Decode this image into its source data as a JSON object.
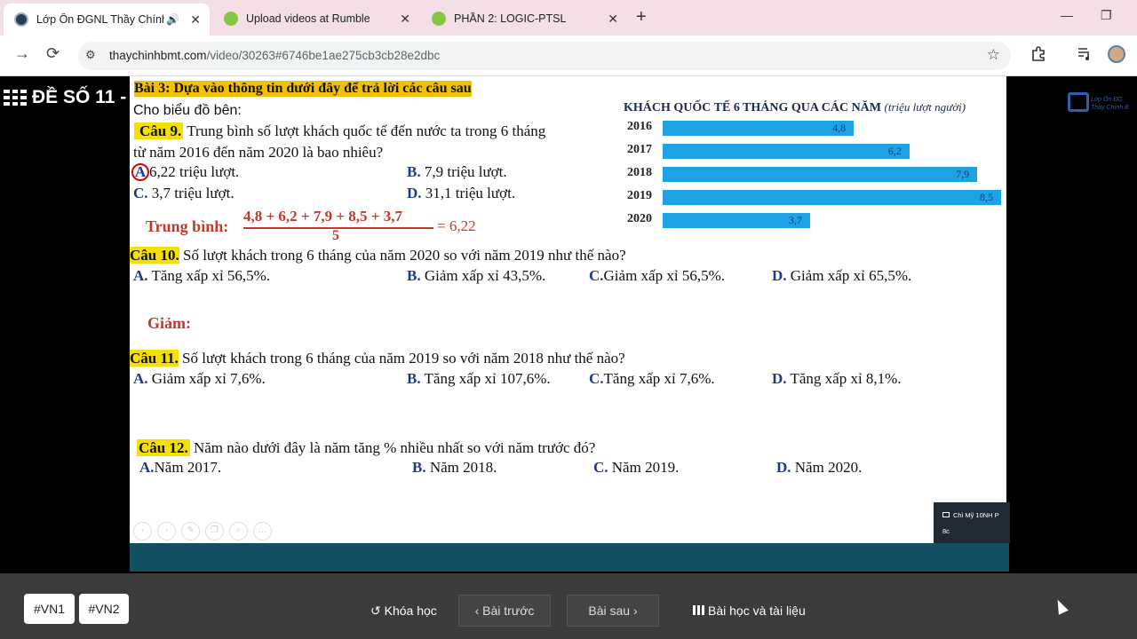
{
  "browser": {
    "tabs": [
      {
        "title": "Lớp Ôn ĐGNL Thầy Chính B",
        "active": true,
        "audio": true
      },
      {
        "title": "Upload videos at Rumble",
        "active": false
      },
      {
        "title": "PHẦN 2: LOGIC-PTSL",
        "active": false
      }
    ],
    "url_host": "thaychinhbmt.com",
    "url_path": "/video/30263#6746be1ae275cb3cb28e2dbc",
    "icons": {
      "back": "arrow-right-icon",
      "reload": "reload-icon",
      "bookmark": "star-icon",
      "extensions": "puzzle-icon",
      "media": "media-control-icon"
    },
    "symbols": {
      "newtab": "+",
      "close": "✕",
      "minimize": "—",
      "restore": "❐",
      "back": "→",
      "reload": "⟳",
      "star": "☆",
      "tune": "⚙",
      "audio": "🔊"
    }
  },
  "course": {
    "title": "ĐỀ SỐ 11 -",
    "logo_text1": "Lớp Ôn ĐG",
    "logo_text2": "Thầy Chính B"
  },
  "slide": {
    "heading": "Bài 3: Dựa vào thông tin dưới đây để trả lời các câu sau",
    "intro": "Cho biểu đồ bên:",
    "q9": {
      "num": "Câu 9.",
      "text1": "Trung bình số lượt khách quốc tế đến nước ta trong 6 tháng",
      "text2": "từ năm 2016 đến năm 2020 là bao nhiêu?",
      "a_label": "A",
      "a": "6,22 triệu lượt.",
      "b_label": "B.",
      "b": "7,9 triệu lượt.",
      "c_label": "C.",
      "c": "3,7 triệu lượt.",
      "d_label": "D.",
      "d": "31,1 triệu lượt."
    },
    "avg_label": "Trung bình:",
    "avg_num": "4,8 + 6,2 + 7,9 + 8,5 + 3,7",
    "avg_den": "5",
    "avg_result": "= 6,22",
    "q10": {
      "num": "Câu 10.",
      "text": "Số lượt khách trong 6 tháng của năm 2020 so với năm 2019 như thế nào?",
      "a_label": "A.",
      "a": "Tăng xấp xỉ 56,5%.",
      "b_label": "B.",
      "b": "Giảm xấp xỉ 43,5%.",
      "c_label": "C.",
      "c": "Giảm xấp xỉ 56,5%.",
      "d_label": "D.",
      "d": "Giảm xấp xỉ 65,5%."
    },
    "note": "Giảm:",
    "q11": {
      "num": "Câu 11.",
      "text": "Số lượt khách trong 6 tháng của năm 2019 so với năm 2018 như thế nào?",
      "a_label": "A.",
      "a": "Giảm xấp xỉ 7,6%.",
      "b_label": "B.",
      "b": "Tăng xấp xỉ 107,6%.",
      "c_label": "C.",
      "c": "Tăng xấp xỉ 7,6%.",
      "d_label": "D.",
      "d": "Tăng xấp xỉ 8,1%."
    },
    "q12": {
      "num": "Câu 12.",
      "text": "Năm nào dưới đây là năm tăng % nhiều nhất so với năm trước đó?",
      "a_label": "A.",
      "a": "Năm 2017.",
      "b_label": "B.",
      "b": "Năm 2018.",
      "c_label": "C.",
      "c": "Năm 2019.",
      "d_label": "D.",
      "d": "Năm 2020."
    }
  },
  "chart_data": {
    "type": "bar",
    "orientation": "horizontal",
    "title": "KHÁCH QUỐC TẾ 6 THÁNG QUA CÁC NĂM",
    "subtitle": "(triệu lượt người)",
    "categories": [
      "2016",
      "2017",
      "2018",
      "2019",
      "2020"
    ],
    "values": [
      4.8,
      6.2,
      7.9,
      8.5,
      3.7
    ],
    "value_labels": [
      "4,8",
      "6,2",
      "7,9",
      "8,5",
      "3,7"
    ],
    "xlim": [
      0,
      8.5
    ],
    "color": "#1ea2e6",
    "grid": false
  },
  "chat": {
    "name": "Chỉ Mỹ 10NH P",
    "time": "8c"
  },
  "bottom": {
    "tag1": "#VN1",
    "tag2": "#VN2",
    "course_link": "Khóa học",
    "prev": "Bài trước",
    "next": "Bài sau",
    "lessons": "Bài học và tài liệu",
    "icons": {
      "course": "↺",
      "prev": "‹",
      "next": "›"
    }
  }
}
